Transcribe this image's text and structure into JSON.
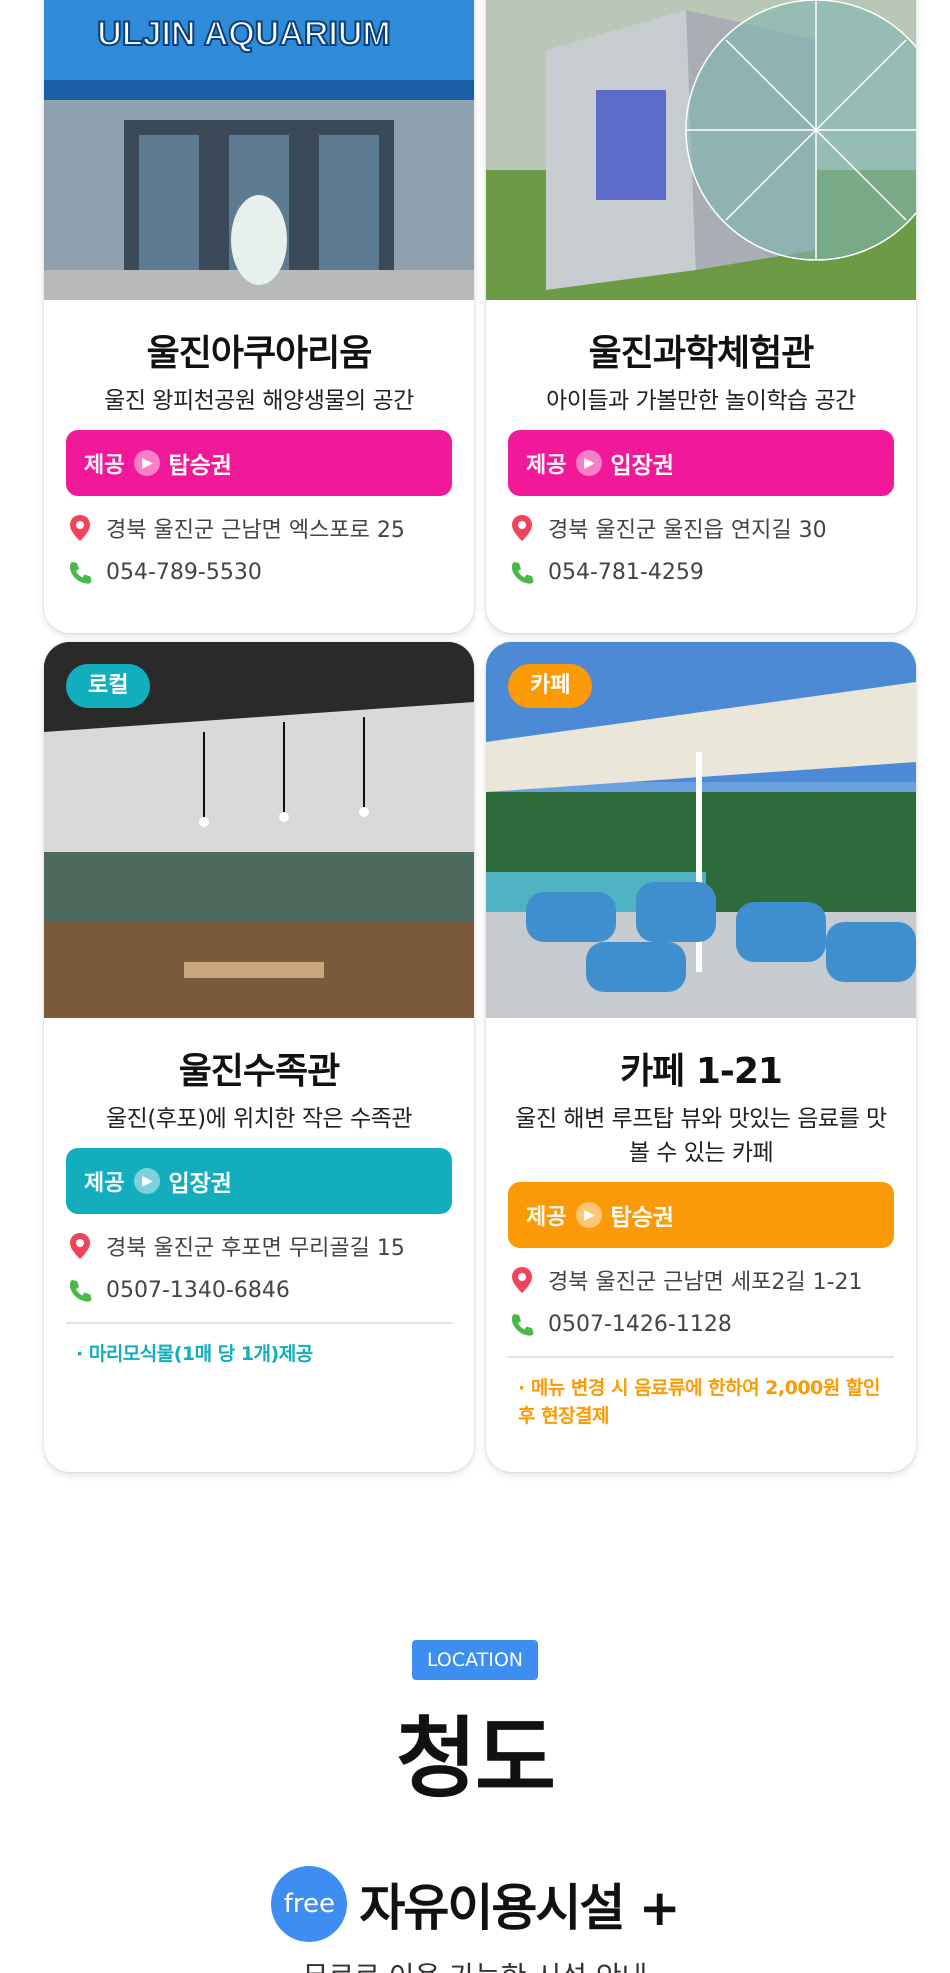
{
  "cards": [
    {
      "title": "울진아쿠아리움",
      "desc": "울진 왕피천공원 해양생물의 공간",
      "offer_label": "제공",
      "offer_value": "탑승권",
      "offer_color": "#f2189a",
      "address": "경북 울진군 근남면 엑스포로 25",
      "phone": "054-789-5530",
      "photo_sign": "ULJIN AQUARIUM"
    },
    {
      "title": "울진과학체험관",
      "desc": "아이들과 가볼만한 놀이학습 공간",
      "offer_label": "제공",
      "offer_value": "입장권",
      "offer_color": "#f2189a",
      "address": "경북 울진군 울진읍 연지길 30",
      "phone": "054-781-4259"
    },
    {
      "tag": "로컬",
      "tag_color": "#12aebe",
      "title": "울진수족관",
      "desc": "울진(후포)에 위치한 작은 수족관",
      "offer_label": "제공",
      "offer_value": "입장권",
      "offer_color": "#12aebe",
      "address": "경북 울진군 후포면 무리골길 15",
      "phone": "0507-1340-6846",
      "note": "· 마리모식물(1매 당 1개)제공",
      "note_color": "#12aebe"
    },
    {
      "tag": "카페",
      "tag_color": "#fb9a06",
      "title": "카페 1-21",
      "desc": "울진 해변 루프탑 뷰와 맛있는 음료를 맛볼 수 있는 카페",
      "offer_label": "제공",
      "offer_value": "탑승권",
      "offer_color": "#fb9a06",
      "address": "경북 울진군 근남면 세포2길 1-21",
      "phone": "0507-1426-1128",
      "note": "· 메뉴 변경 시 음료류에 한하여 2,000원 할인 후 현장결제",
      "note_color": "#fb9a06"
    }
  ],
  "location": {
    "badge": "LOCATION",
    "title": "청도"
  },
  "free": {
    "circle": "free",
    "title": "자유이용시설 +",
    "subtitle": "무료로 이용 가능한 시설 안내"
  },
  "icons": {
    "address": "map-pin-icon",
    "phone": "phone-icon",
    "offer_arrow": "chevron-right-icon"
  }
}
